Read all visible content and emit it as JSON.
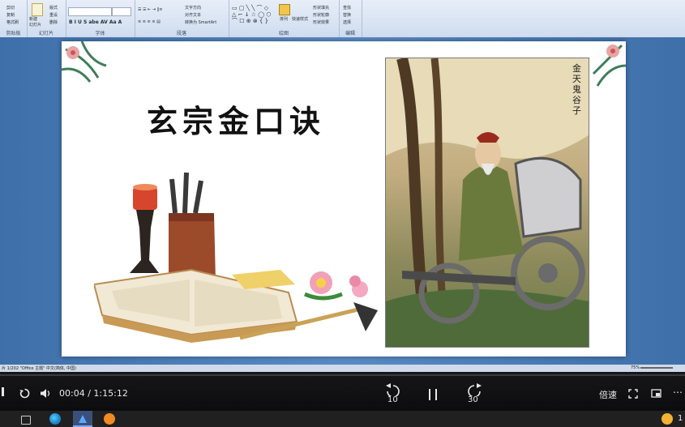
{
  "ribbon": {
    "group_labels": [
      "剪贴板",
      "幻灯片",
      "字体",
      "段落",
      "绘图",
      "编辑"
    ],
    "new_slide_label": "新建\n幻灯片",
    "buttons": {
      "cut": "剪切",
      "copy": "复制",
      "format_painter": "格式刷",
      "layout": "版式",
      "reset": "重设",
      "delete": "删除",
      "text_direction": "文字方向",
      "align_text": "对齐文本",
      "convert_smartart": "转换为 SmartArt",
      "arrange": "排列",
      "quick_styles": "快速样式",
      "shape_fill": "形状填充",
      "shape_outline": "形状轮廓",
      "shape_effects": "形状效果",
      "find": "查找",
      "replace": "替换",
      "select": "选择"
    }
  },
  "slide": {
    "title": "玄宗金口诀",
    "painting_caption": "金天鬼谷子",
    "colors": {
      "title": "#111111"
    }
  },
  "statusbar": {
    "left": "片 1/202   \"Office 主题\"   中文(简体, 中国)",
    "zoom": "75%"
  },
  "player": {
    "time_current": "00:04",
    "time_separator": "/",
    "time_total": "1:15:12",
    "rewind_label": "10",
    "forward_label": "30",
    "speed_label": "倍速"
  },
  "taskbar": {
    "tray_text": "1"
  }
}
